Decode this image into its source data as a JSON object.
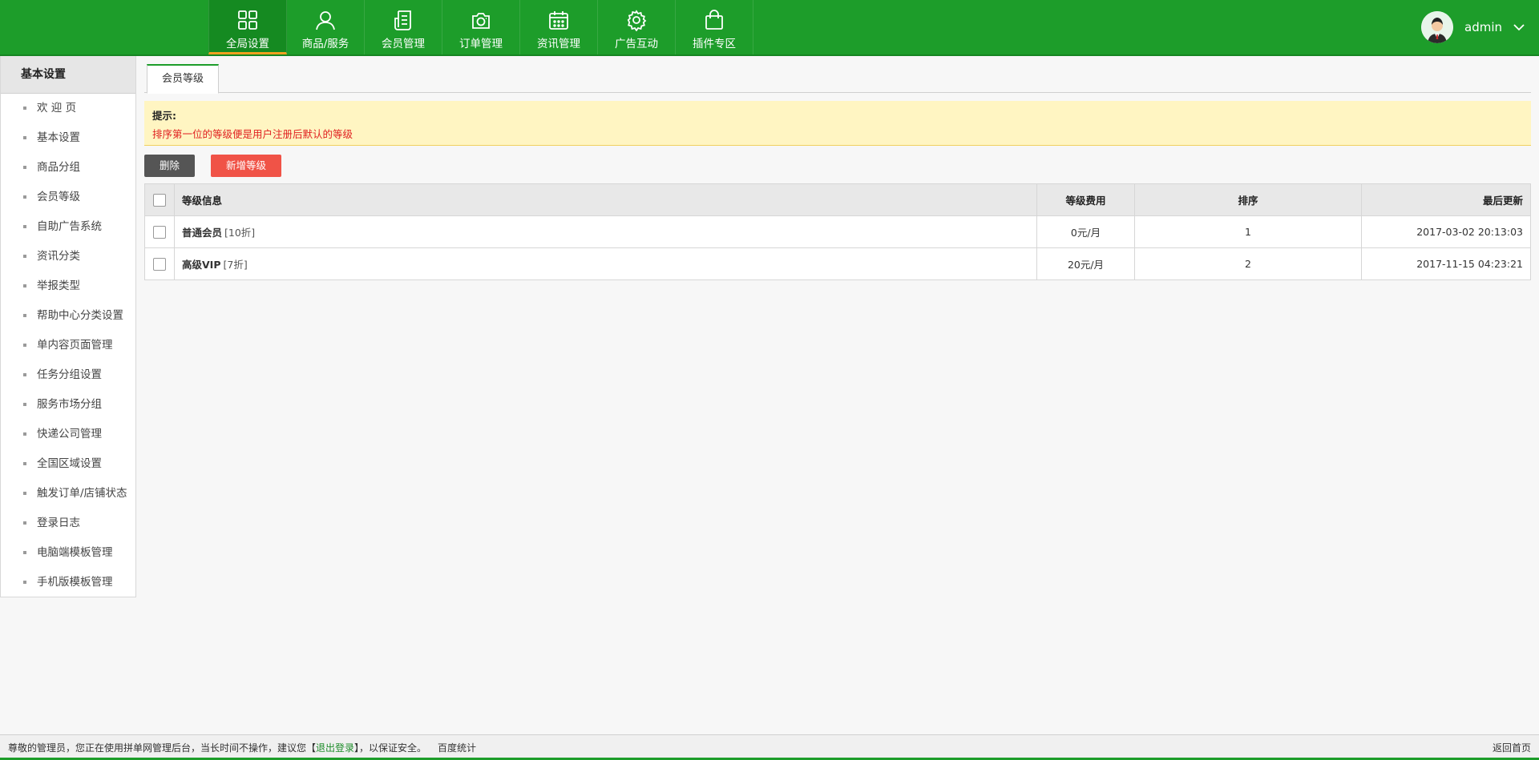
{
  "nav": {
    "items": [
      {
        "label": "全局设置",
        "icon": "grid-icon",
        "active": true
      },
      {
        "label": "商品/服务",
        "icon": "user-icon"
      },
      {
        "label": "会员管理",
        "icon": "document-icon"
      },
      {
        "label": "订单管理",
        "icon": "camera-icon"
      },
      {
        "label": "资讯管理",
        "icon": "calendar-icon"
      },
      {
        "label": "广告互动",
        "icon": "gear-icon"
      },
      {
        "label": "插件专区",
        "icon": "bag-icon"
      }
    ]
  },
  "user": {
    "name": "admin"
  },
  "sidebar": {
    "title": "基本设置",
    "items": [
      {
        "label": "欢 迎 页"
      },
      {
        "label": "基本设置"
      },
      {
        "label": "商品分组"
      },
      {
        "label": "会员等级"
      },
      {
        "label": "自助广告系统"
      },
      {
        "label": "资讯分类"
      },
      {
        "label": "举报类型"
      },
      {
        "label": "帮助中心分类设置"
      },
      {
        "label": "单内容页面管理"
      },
      {
        "label": "任务分组设置"
      },
      {
        "label": "服务市场分组"
      },
      {
        "label": "快递公司管理"
      },
      {
        "label": "全国区域设置"
      },
      {
        "label": "触发订单/店铺状态"
      },
      {
        "label": "登录日志"
      },
      {
        "label": "电脑端模板管理"
      },
      {
        "label": "手机版模板管理"
      }
    ]
  },
  "main": {
    "tab": "会员等级",
    "tip": {
      "title": "提示:",
      "text": "排序第一位的等级便是用户注册后默认的等级"
    },
    "buttons": {
      "delete": "删除",
      "add": "新增等级"
    },
    "table": {
      "headers": {
        "info": "等级信息",
        "fee": "等级费用",
        "sort": "排序",
        "updated": "最后更新"
      },
      "rows": [
        {
          "name": "普通会员",
          "tag": "[10折]",
          "fee": "0元/月",
          "sort": "1",
          "updated": "2017-03-02 20:13:03"
        },
        {
          "name": "高级VIP",
          "tag": "[7折]",
          "fee": "20元/月",
          "sort": "2",
          "updated": "2017-11-15 04:23:21"
        }
      ]
    }
  },
  "footer": {
    "notice_before": "尊敬的管理员，您正在使用拼单网管理后台，当长时间不操作，建议您【",
    "logout_link": "退出登录",
    "notice_after": "】，以保证安全。",
    "stats_link": "百度统计",
    "home_link": "返回首页"
  },
  "colors": {
    "brand": "#1d9d2a",
    "danger_button": "#f05347",
    "tip_background": "#fff5c2"
  }
}
